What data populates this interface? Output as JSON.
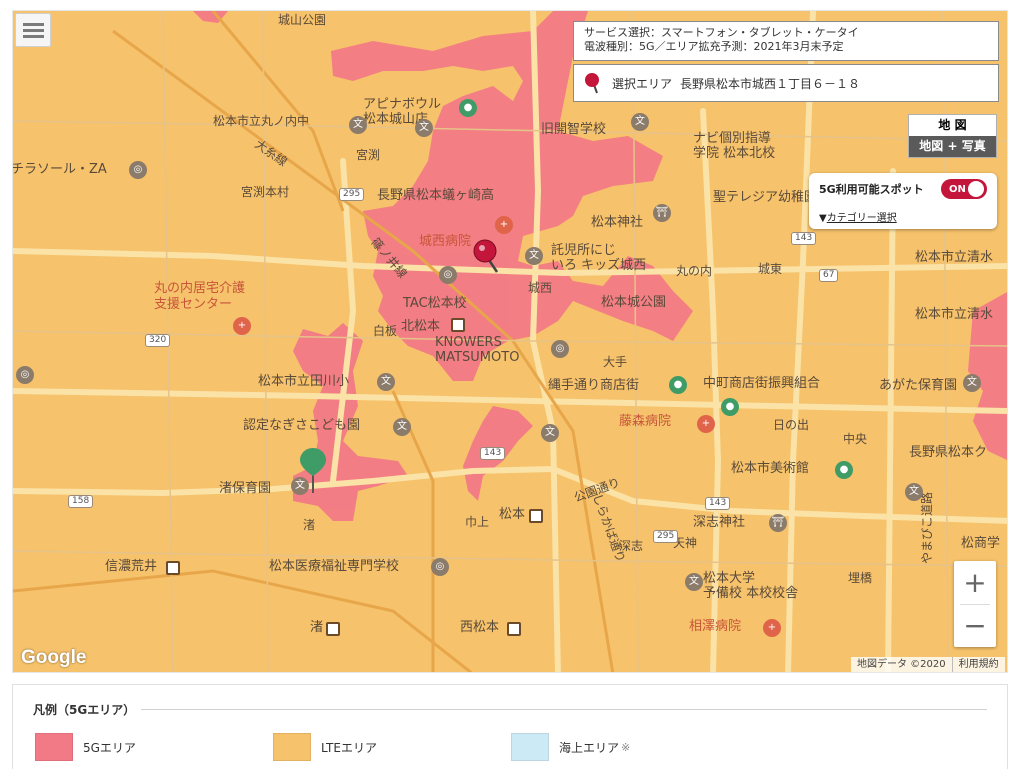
{
  "map": {
    "labels": {
      "joyama_park": "城山公園",
      "marunouchi_jhs": "松本市立丸ノ内中",
      "apina_bowl": "アピナボウル\n松本城山店",
      "miyabuchi": "宮渕",
      "omyo_line": "大糸線",
      "sunsol": "チラソール・ZA",
      "miyabuchi_honmura": "宮渕本村",
      "agatagaoka_high": "長野県松本蟻ヶ崎高",
      "kaichi_school": "旧開智学校",
      "navi_kobetsu": "ナビ個別指導\n学院 松本北校",
      "telegia": "聖テレジア幼稚園",
      "matsumoto_shrine": "松本神社",
      "josai_hospital": "城西病院",
      "takujisho": "託児所にじ\nいろ キッズ城西",
      "shinonoi_line": "篠ノ井線",
      "tac": "TAC松本校",
      "kitamatsumoto": "北松本",
      "matsumoto_castle_park": "松本城公園",
      "marunouchi_care": "丸の内居宅介護\n支援センター",
      "knowers": "KNOWERS\nMATSUMOTO",
      "josai": "城西",
      "shirakabe": "白板",
      "tagawa_es": "松本市立田川小",
      "nawate": "縄手通り商店街",
      "nakamachi": "中町商店街振興組合",
      "agata_nursery": "あがた保育園",
      "nagisa_kodomoen": "認定なぎさこども園",
      "fujimori": "藤森病院",
      "nagisa_nursery": "渚保育園",
      "art_museum": "松本市美術館",
      "nagano_matsumoto": "長野県松本ク",
      "nagisa": "渚",
      "nakaue": "巾上",
      "matsumoto_st": "松本",
      "fukashi_shrine": "深志神社",
      "shinanoarai": "信濃荒井",
      "iryou_senmon": "松本医療福祉専門学校",
      "matsumoto_univ": "松本大学\n予備校 本校校舎",
      "nishi_matsumoto": "西松本",
      "aizawa": "相澤病院",
      "nagisa_sta": "渚",
      "kitafukashi": "松本北校",
      "shimizu1": "松本市立清水",
      "shimizu2": "松本市立清水",
      "kimacho": "鳩鶴",
      "nakamachi2": "中央",
      "yamabiko": "やまびこ道路",
      "matsunomi": "松商学",
      "ohte": "大手",
      "fukashi": "深志",
      "tenjin": "天神",
      "kamiyamachi": "埋橋",
      "wakamatsu": "丸の内",
      "shirakaba": "しらかば通り",
      "koen": "公園通り",
      "josaidori": "城東",
      "hinode": "日の出",
      "aoyagi": "松本北校"
    },
    "route_numbers": [
      "295",
      "143",
      "67",
      "320",
      "143",
      "143",
      "158",
      "295"
    ],
    "google_logo": "Google",
    "credits": {
      "data": "地図データ ©2020",
      "terms": "利用規約"
    }
  },
  "info_box": {
    "line1": "サービス選択：スマートフォン・タブレット・ケータイ",
    "line2": "電波種別：5G／エリア拡充予測：2021年3月末予定"
  },
  "area_box": {
    "label": "選択エリア",
    "address": "長野県松本市城西１丁目６－１８"
  },
  "map_type": {
    "options": [
      "地 図",
      "地図 + 写真"
    ],
    "selected": "地図 + 写真"
  },
  "spot": {
    "title": "5G利用可能スポット",
    "toggle": "ON",
    "category": "カテゴリー選択",
    "category_prefix": "▼"
  },
  "zoom": {
    "plus": "+",
    "minus": "−"
  },
  "legend": {
    "title": "凡例（5Gエリア）",
    "items": [
      {
        "label": "5Gエリア",
        "color": "#f27a86"
      },
      {
        "label": "LTEエリア",
        "color": "#f6c26b"
      },
      {
        "label": "海上エリア",
        "color": "#cce9f6",
        "note": "※"
      }
    ]
  },
  "colors": {
    "lte": "#f6c26b",
    "fiveg": "#f27a86",
    "marker": "#c4153a",
    "pin_green": "#3f9c67"
  }
}
